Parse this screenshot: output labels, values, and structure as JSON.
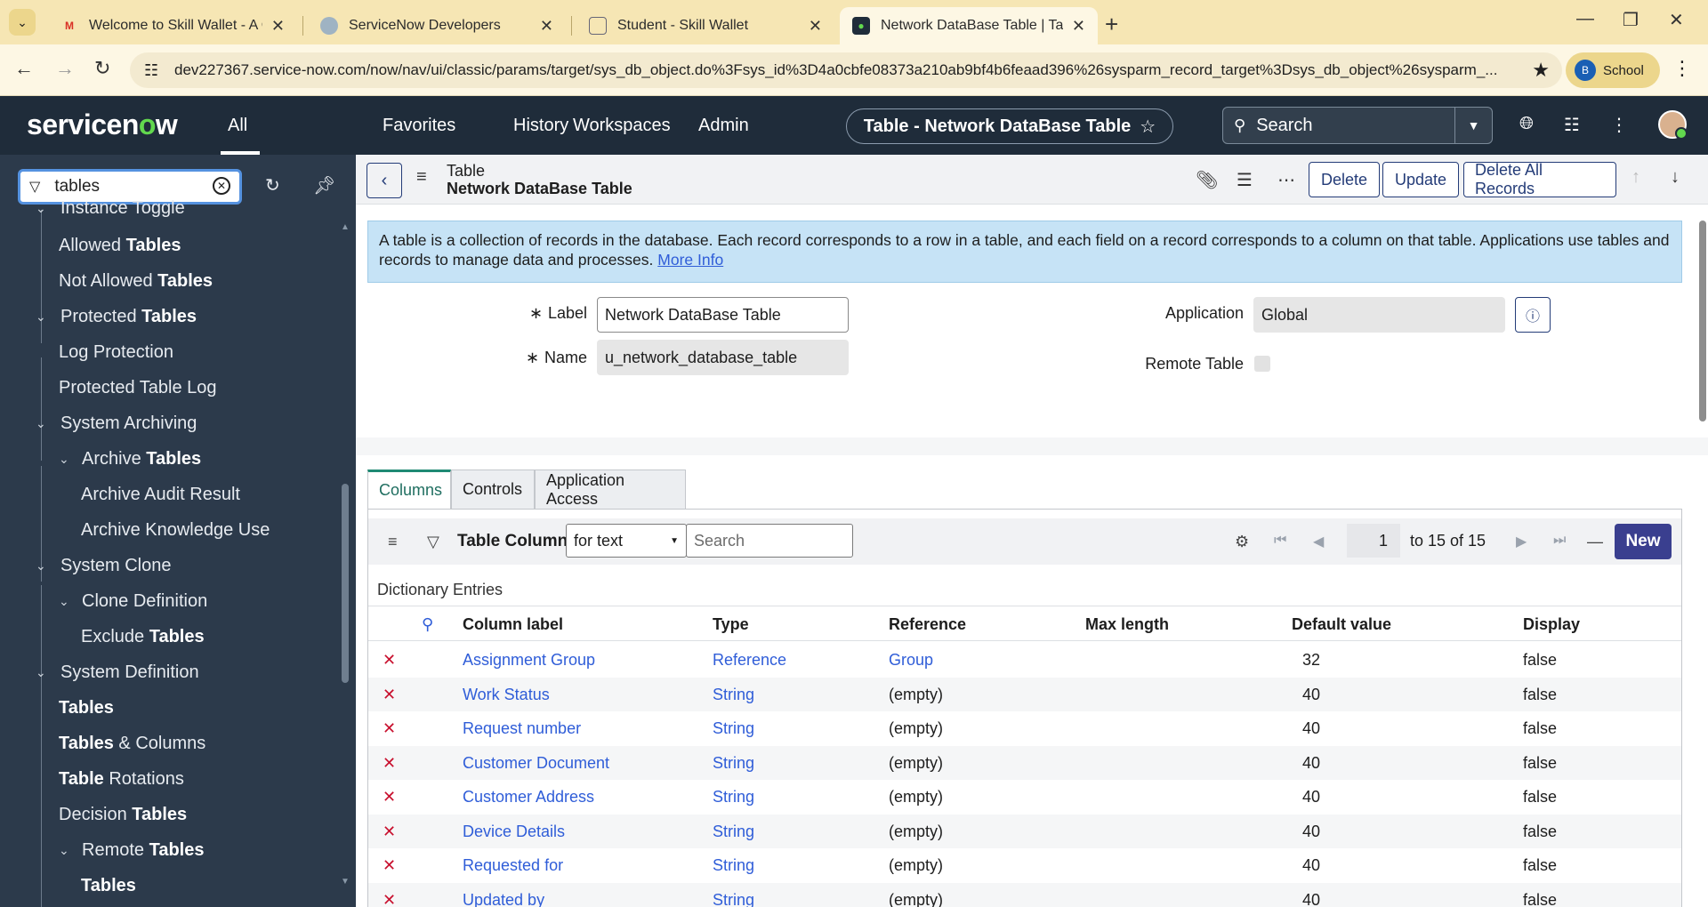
{
  "browser": {
    "tabs": [
      {
        "title": "Welcome to Skill Wallet - A One",
        "favicon": "gmail-icon"
      },
      {
        "title": "ServiceNow Developers",
        "favicon": "servicenow-dev-icon"
      },
      {
        "title": "Student - Skill Wallet",
        "favicon": "skill-wallet-icon"
      },
      {
        "title": "Network DataBase Table | Table",
        "favicon": "servicenow-icon"
      }
    ],
    "url": "dev227367.service-now.com/now/nav/ui/classic/params/target/sys_db_object.do%3Fsys_id%3D4a0cbfe08373a210ab9bf4b6feaad396%26sysparm_record_target%3Dsys_db_object%26sysparm_...",
    "profile_initial": "B",
    "profile_name": "School"
  },
  "header": {
    "logo": "servicenow",
    "all": "All",
    "nav": [
      "Favorites",
      "History",
      "Workspaces",
      "Admin"
    ],
    "context_title": "Table - Network DataBase Table",
    "search_placeholder": "Search"
  },
  "sidebar": {
    "filter_value": "tables",
    "items": [
      {
        "pre": "Instance Toggle",
        "bold": "",
        "post": ""
      },
      {
        "pre": "Allowed ",
        "bold": "Tables",
        "post": ""
      },
      {
        "pre": "Not Allowed ",
        "bold": "Tables",
        "post": ""
      },
      {
        "pre": "Protected ",
        "bold": "Tables",
        "post": ""
      },
      {
        "pre": "Log Protection",
        "bold": "",
        "post": ""
      },
      {
        "pre": "Protected Table Log",
        "bold": "",
        "post": ""
      },
      {
        "pre": "System Archiving",
        "bold": "",
        "post": ""
      },
      {
        "pre": "Archive ",
        "bold": "Tables",
        "post": ""
      },
      {
        "pre": "Archive Audit Result",
        "bold": "",
        "post": ""
      },
      {
        "pre": "Archive Knowledge Use",
        "bold": "",
        "post": ""
      },
      {
        "pre": "System Clone",
        "bold": "",
        "post": ""
      },
      {
        "pre": "Clone Definition",
        "bold": "",
        "post": ""
      },
      {
        "pre": "Exclude ",
        "bold": "Tables",
        "post": ""
      },
      {
        "pre": "System Definition",
        "bold": "",
        "post": ""
      },
      {
        "pre": "",
        "bold": "Tables",
        "post": ""
      },
      {
        "pre": "",
        "bold": "Tables",
        "post": " & Columns"
      },
      {
        "pre": "",
        "bold": "Table",
        "post": " Rotations"
      },
      {
        "pre": "Decision ",
        "bold": "Tables",
        "post": ""
      },
      {
        "pre": "Remote ",
        "bold": "Tables",
        "post": ""
      },
      {
        "pre": "",
        "bold": "Tables",
        "post": ""
      }
    ]
  },
  "form": {
    "record_type": "Table",
    "record_name": "Network DataBase Table",
    "buttons": {
      "delete": "Delete",
      "update": "Update",
      "delete_all": "Delete All Records"
    },
    "banner_text": "A table is a collection of records in the database. Each record corresponds to a row in a table, and each field on a record corresponds to a column on that table. Applications use tables and records to manage data and processes.",
    "banner_link": "More Info",
    "label_label": "Label",
    "label_value": "Network DataBase Table",
    "name_label": "Name",
    "name_value": "u_network_database_table",
    "application_label": "Application",
    "application_value": "Global",
    "remote_label": "Remote Table",
    "required_mark": "∗"
  },
  "related": {
    "tabs": [
      "Columns",
      "Controls",
      "Application Access"
    ],
    "list_title": "Table Columns",
    "filter_select": "for text",
    "search_placeholder": "Search",
    "page_current": "1",
    "page_text": "to 15 of 15",
    "new_label": "New",
    "section_title": "Dictionary Entries",
    "columns": [
      "Column label",
      "Type",
      "Reference",
      "Max length",
      "Default value",
      "Display"
    ],
    "rows": [
      {
        "label": "Assignment Group",
        "type": "Reference",
        "reference": "Group",
        "max": "32",
        "default": "",
        "display": "false"
      },
      {
        "label": "Work Status",
        "type": "String",
        "reference": "(empty)",
        "max": "40",
        "default": "",
        "display": "false"
      },
      {
        "label": "Request number",
        "type": "String",
        "reference": "(empty)",
        "max": "40",
        "default": "",
        "display": "false"
      },
      {
        "label": "Customer Document",
        "type": "String",
        "reference": "(empty)",
        "max": "40",
        "default": "",
        "display": "false"
      },
      {
        "label": "Customer Address",
        "type": "String",
        "reference": "(empty)",
        "max": "40",
        "default": "",
        "display": "false"
      },
      {
        "label": "Device Details",
        "type": "String",
        "reference": "(empty)",
        "max": "40",
        "default": "",
        "display": "false"
      },
      {
        "label": "Requested for",
        "type": "String",
        "reference": "(empty)",
        "max": "40",
        "default": "",
        "display": "false"
      },
      {
        "label": "Updated by",
        "type": "String",
        "reference": "(empty)",
        "max": "40",
        "default": "",
        "display": "false"
      }
    ]
  },
  "colors": {
    "header_bg": "#1f2c3a",
    "sidebar_bg": "#2c3a4b",
    "link": "#2f5dd8",
    "new_button": "#3a3f8f",
    "banner": "#c6e3f6"
  }
}
